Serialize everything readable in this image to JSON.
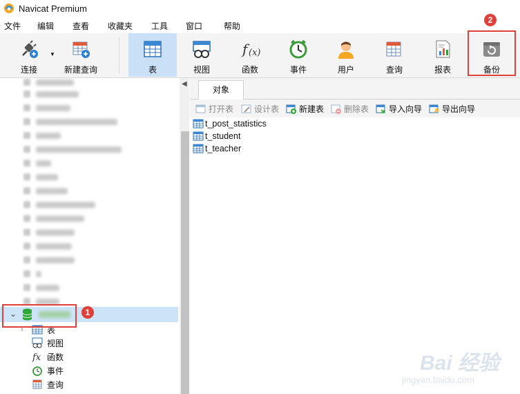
{
  "window": {
    "title": "Navicat Premium"
  },
  "menu": [
    "文件",
    "编辑",
    "查看",
    "收藏夹",
    "工具",
    "窗口",
    "帮助"
  ],
  "toolbar": {
    "connect": "连接",
    "new_query": "新建查询",
    "table": "表",
    "view": "视图",
    "function": "函数",
    "event": "事件",
    "user": "用户",
    "query": "查询",
    "report": "报表",
    "backup": "备份"
  },
  "annotations": {
    "badge_1": "1",
    "badge_2": "2"
  },
  "tree": {
    "children": [
      "表",
      "视图",
      "函数",
      "事件",
      "查询"
    ]
  },
  "object_tab": {
    "label": "对象"
  },
  "object_toolbar": {
    "open_table": "打开表",
    "design_table": "设计表",
    "new_table": "新建表",
    "delete_table": "删除表",
    "import_wizard": "导入向导",
    "export_wizard": "导出向导"
  },
  "tables": [
    "t_post_statistics",
    "t_student",
    "t_teacher"
  ],
  "watermark": {
    "brand": "Bai 经验",
    "url": "jingyan.baidu.com"
  },
  "colors": {
    "accent": "#c9e0f7",
    "selection": "#cce4f7",
    "annotation_red": "#e0403a"
  }
}
